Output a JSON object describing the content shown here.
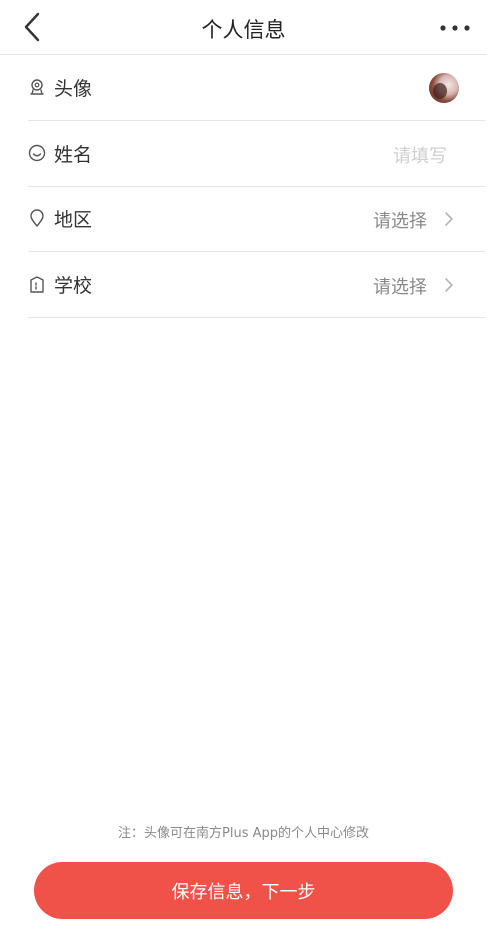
{
  "header": {
    "title": "个人信息"
  },
  "rows": [
    {
      "label": "头像",
      "icon": "avatar-icon"
    },
    {
      "label": "姓名",
      "icon": "smile-icon",
      "placeholder": "请填写"
    },
    {
      "label": "地区",
      "icon": "location-pin-icon",
      "value": "请选择"
    },
    {
      "label": "学校",
      "icon": "school-icon",
      "value": "请选择"
    }
  ],
  "footer": {
    "note": "注：头像可在南方Plus App的个人中心修改",
    "submit_label": "保存信息，下一步"
  },
  "colors": {
    "accent": "#f0524a",
    "divider": "#e6e6e6",
    "secondary_text": "#8a8a8a"
  }
}
